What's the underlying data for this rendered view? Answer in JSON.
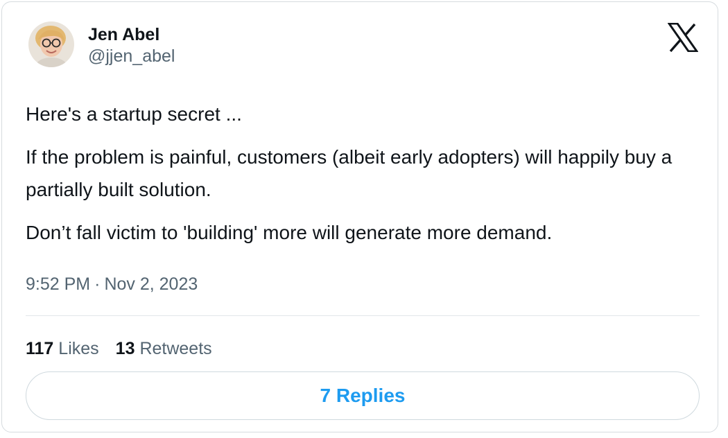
{
  "author": {
    "name": "Jen Abel",
    "handle": "@jjen_abel",
    "avatar_icon": "profile-photo-avatar"
  },
  "logo": {
    "icon": "x-logo-icon"
  },
  "tweet": {
    "paragraphs": [
      "Here's a startup secret ...",
      "If the problem is painful, customers (albeit early adopters) will happily buy a partially built solution.",
      "Don’t fall victim to 'building' more will generate more demand."
    ],
    "time": "9:52 PM",
    "separator": "·",
    "date": "Nov 2, 2023"
  },
  "stats": {
    "likes_count": "117",
    "likes_label": "Likes",
    "retweets_count": "13",
    "retweets_label": "Retweets"
  },
  "replies_button": {
    "label": "7 Replies"
  },
  "colors": {
    "text_primary": "#0f1419",
    "text_secondary": "#536471",
    "accent": "#1d9bf0",
    "border": "#cfd9de"
  }
}
